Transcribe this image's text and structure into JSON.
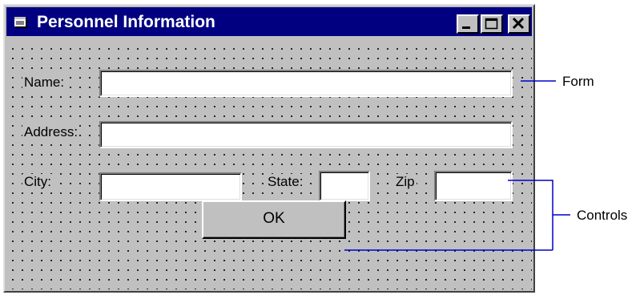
{
  "window": {
    "title": "Personnel Information",
    "colors": {
      "title_bar": "#000080",
      "face": "#c0c0c0"
    }
  },
  "form": {
    "name_label": "Name:",
    "address_label": "Address:",
    "city_label": "City:",
    "state_label": "State:",
    "zip_label": "Zip",
    "name_value": "",
    "address_value": "",
    "city_value": "",
    "state_value": "",
    "zip_value": "",
    "ok_label": "OK"
  },
  "callouts": {
    "form_label": "Form",
    "controls_label": "Controls",
    "line_color": "#0000cc"
  }
}
